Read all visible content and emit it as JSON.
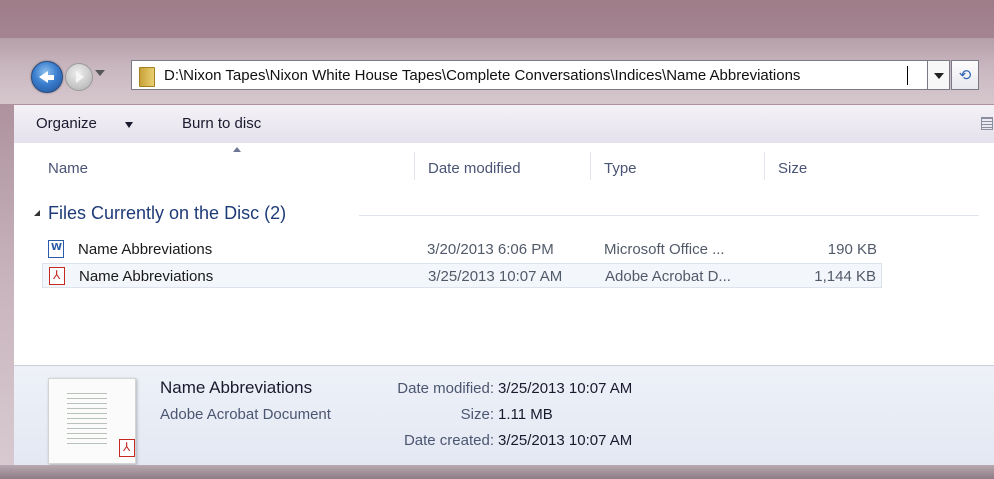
{
  "address_bar": {
    "path": "D:\\Nixon Tapes\\Nixon White House Tapes\\Complete Conversations\\Indices\\Name Abbreviations"
  },
  "toolbar": {
    "organize_label": "Organize",
    "burn_label": "Burn to disc"
  },
  "columns": {
    "name": "Name",
    "date_modified": "Date modified",
    "type": "Type",
    "size": "Size"
  },
  "group": {
    "label": "Files Currently on the Disc (2)"
  },
  "files": [
    {
      "name": "Name Abbreviations",
      "date": "3/20/2013 6:06 PM",
      "type": "Microsoft Office ...",
      "size": "190 KB",
      "icon": "word-document-icon"
    },
    {
      "name": "Name Abbreviations",
      "date": "3/25/2013 10:07 AM",
      "type": "Adobe Acrobat D...",
      "size": "1,144 KB",
      "icon": "pdf-document-icon"
    }
  ],
  "details": {
    "title": "Name Abbreviations",
    "subtitle": "Adobe Acrobat Document",
    "date_modified_label": "Date modified:",
    "date_modified_value": "3/25/2013 10:07 AM",
    "size_label": "Size:",
    "size_value": "1.11 MB",
    "date_created_label": "Date created:",
    "date_created_value": "3/25/2013 10:07 AM"
  },
  "icons": {
    "back": "back-arrow-icon",
    "forward": "forward-arrow-icon",
    "refresh": "refresh-icon",
    "folder": "folder-icon",
    "view": "view-options-icon"
  }
}
